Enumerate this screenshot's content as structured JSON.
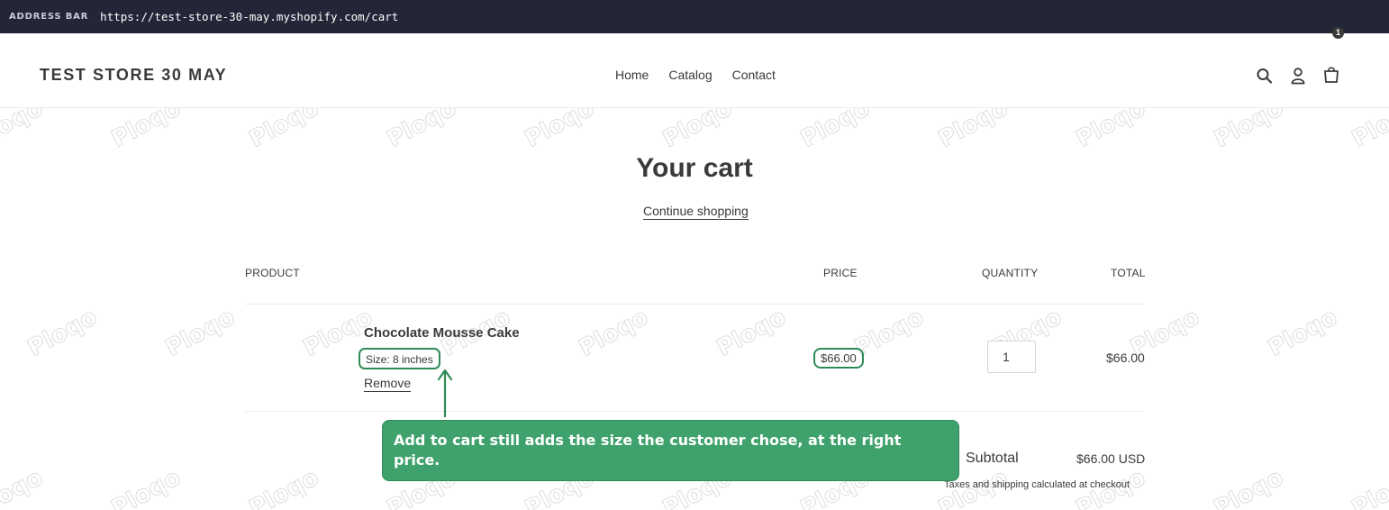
{
  "browser": {
    "address_label": "ADDRESS BAR",
    "url": "https://test-store-30-may.myshopify.com/cart"
  },
  "header": {
    "store_name": "TEST STORE 30 MAY",
    "nav": [
      {
        "label": "Home"
      },
      {
        "label": "Catalog"
      },
      {
        "label": "Contact"
      }
    ],
    "icons": [
      "search-icon",
      "account-icon",
      "cart-icon"
    ],
    "cart_count": "1"
  },
  "cart": {
    "title": "Your cart",
    "continue_label": "Continue shopping",
    "columns": {
      "product": "PRODUCT",
      "price": "PRICE",
      "quantity": "QUANTITY",
      "total": "TOTAL"
    },
    "items": [
      {
        "name": "Chocolate Mousse Cake",
        "size": "Size: 8 inches",
        "remove_label": "Remove",
        "price": "$66.00",
        "quantity": "1",
        "total": "$66.00"
      }
    ],
    "subtotal_label": "Subtotal",
    "subtotal_value": "$66.00 USD",
    "tax_note": "Taxes and shipping calculated at checkout"
  },
  "watermark_text": "Ploqo",
  "annotation": {
    "text": "Add to cart still adds the size the customer chose, at the right price.",
    "color": "#3fa26c",
    "highlight_color": "#2e8b57"
  }
}
